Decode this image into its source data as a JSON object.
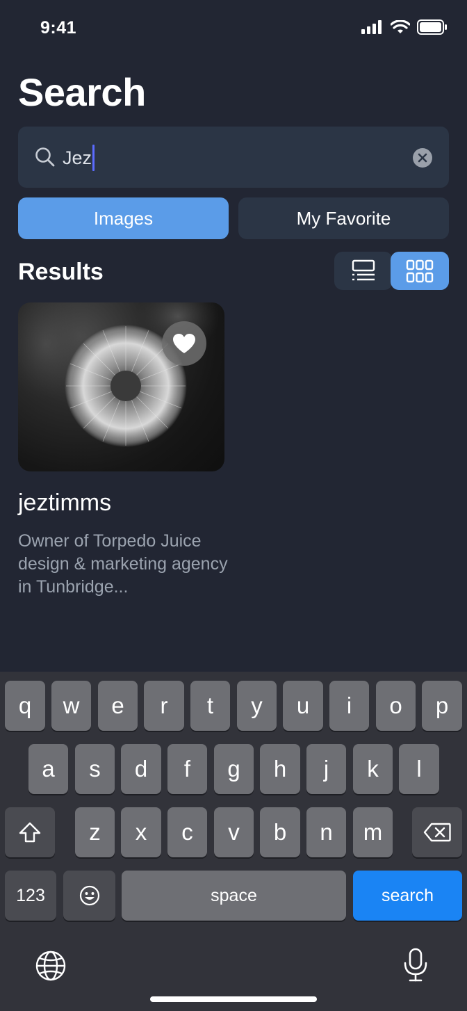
{
  "status": {
    "time": "9:41"
  },
  "header": {
    "title": "Search"
  },
  "search": {
    "value": "Jez",
    "icon": "search-icon",
    "clear_icon": "clear-icon"
  },
  "tabs": [
    {
      "label": "Images",
      "selected": true
    },
    {
      "label": "My Favorite",
      "selected": false
    }
  ],
  "results": {
    "title": "Results",
    "view_modes": [
      {
        "name": "list-view-icon",
        "selected": false
      },
      {
        "name": "grid-view-icon",
        "selected": true
      }
    ],
    "items": [
      {
        "name": "jeztimms",
        "description": "Owner of Torpedo Juice design & marketing agency in Tunbridge...",
        "favorite_icon": "heart-icon"
      }
    ]
  },
  "keyboard": {
    "row1": [
      "q",
      "w",
      "e",
      "r",
      "t",
      "y",
      "u",
      "i",
      "o",
      "p"
    ],
    "row2": [
      "a",
      "s",
      "d",
      "f",
      "g",
      "h",
      "j",
      "k",
      "l"
    ],
    "row3": [
      "z",
      "x",
      "c",
      "v",
      "b",
      "n",
      "m"
    ],
    "numbers_key": "123",
    "space_key": "space",
    "action_key": "search",
    "icons": [
      "shift-icon",
      "backspace-icon",
      "emoji-icon",
      "globe-icon",
      "microphone-icon"
    ]
  },
  "colors": {
    "background": "#222633",
    "accent": "#5b9ce8",
    "keyboard_action": "#1a84f4"
  }
}
